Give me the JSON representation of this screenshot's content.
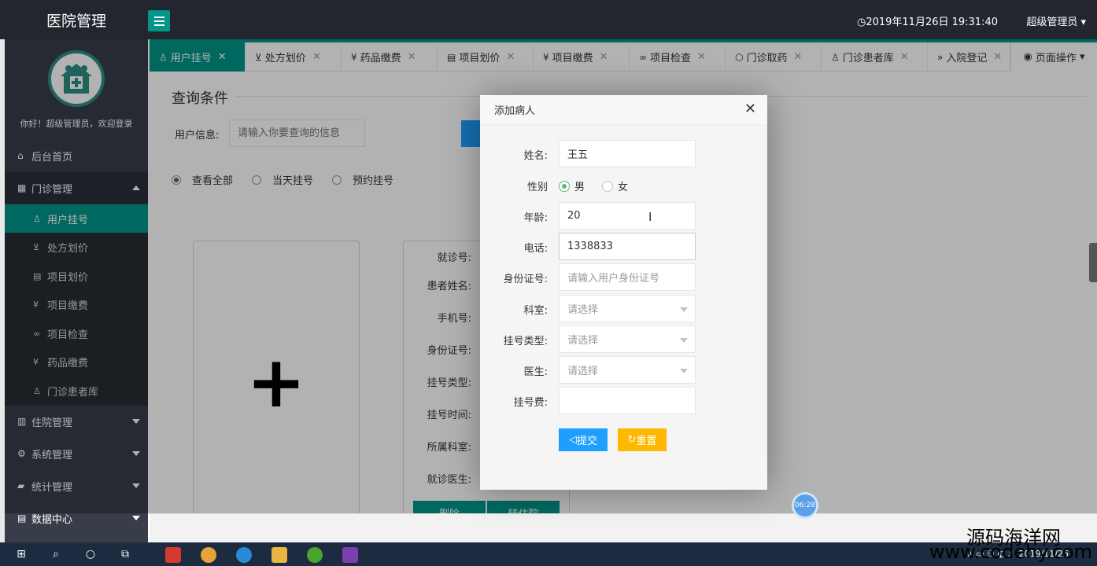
{
  "app": {
    "title": "医院管理",
    "datetime": "2019年11月26日 19:31:40",
    "user": "超级管理员"
  },
  "sidebar": {
    "welcome": "你好！超级管理员，欢迎登录",
    "items": [
      {
        "label": "后台首页",
        "icon": "home-icon"
      },
      {
        "label": "门诊管理",
        "icon": "apps-icon",
        "expanded": true
      },
      {
        "label": "住院管理",
        "icon": "building-icon"
      },
      {
        "label": "系统管理",
        "icon": "gear-icon"
      },
      {
        "label": "统计管理",
        "icon": "chart-icon"
      },
      {
        "label": "数据中心",
        "icon": "database-icon"
      }
    ],
    "subitems": [
      {
        "label": "用户挂号",
        "icon": "user-icon",
        "active": true
      },
      {
        "label": "处方划价",
        "icon": "cart-icon"
      },
      {
        "label": "项目划价",
        "icon": "document-icon"
      },
      {
        "label": "项目缴费",
        "icon": "yen-icon"
      },
      {
        "label": "项目检查",
        "icon": "link-icon"
      },
      {
        "label": "药品缴费",
        "icon": "yen-icon"
      },
      {
        "label": "门诊患者库",
        "icon": "user-icon"
      }
    ]
  },
  "tabs": [
    {
      "label": "用户挂号",
      "icon": "user-icon",
      "active": true
    },
    {
      "label": "处方划价",
      "icon": "cart-icon"
    },
    {
      "label": "药品缴费",
      "icon": "yen-icon"
    },
    {
      "label": "项目划价",
      "icon": "document-icon"
    },
    {
      "label": "项目缴费",
      "icon": "yen-icon"
    },
    {
      "label": "项目检查",
      "icon": "link-icon"
    },
    {
      "label": "门诊取药",
      "icon": "box-icon"
    },
    {
      "label": "门诊患者库",
      "icon": "user-icon"
    },
    {
      "label": "入院登记",
      "icon": "double-chevron-icon"
    }
  ],
  "page_ops": "页面操作",
  "query": {
    "title": "查询条件",
    "user_info_label": "用户信息:",
    "user_info_placeholder": "请输入你要查询的信息",
    "radios": [
      {
        "label": "查看全部",
        "checked": true
      },
      {
        "label": "当天挂号",
        "checked": false
      },
      {
        "label": "预约挂号",
        "checked": false
      }
    ]
  },
  "info_card": {
    "labels": [
      "就诊号:",
      "患者姓名:",
      "手机号:",
      "身份证号:",
      "挂号类型:",
      "挂号时间:",
      "所属科室:",
      "就诊医生:"
    ],
    "buttons": [
      "删除",
      "转住院"
    ]
  },
  "plus_card": {
    "symbol": "+"
  },
  "dialog": {
    "title": "添加病人",
    "fields": {
      "name": {
        "label": "姓名:",
        "value": "王五"
      },
      "gender": {
        "label": "性别",
        "options": [
          "男",
          "女"
        ],
        "selected": "男"
      },
      "age": {
        "label": "年龄:",
        "value": "20"
      },
      "phone": {
        "label": "电话:",
        "value": "1338833"
      },
      "idcard": {
        "label": "身份证号:",
        "placeholder": "请输入用户身份证号"
      },
      "dept": {
        "label": "科室:",
        "placeholder": "请选择"
      },
      "reg_type": {
        "label": "挂号类型:",
        "placeholder": "请选择"
      },
      "doctor": {
        "label": "医生:",
        "placeholder": "请选择"
      },
      "fee": {
        "label": "挂号费:",
        "value": ""
      }
    },
    "submit": "提交",
    "reset": "重置"
  },
  "floater": "06:28",
  "watermark": "源码海洋网",
  "watermark_url": "www.codehy.com",
  "taskbar": {
    "date": "2019/11/26"
  },
  "colors": {
    "primary": "#009688",
    "blue": "#1e9fff",
    "yellow": "#ffb800",
    "sidebar": "#393d49"
  }
}
